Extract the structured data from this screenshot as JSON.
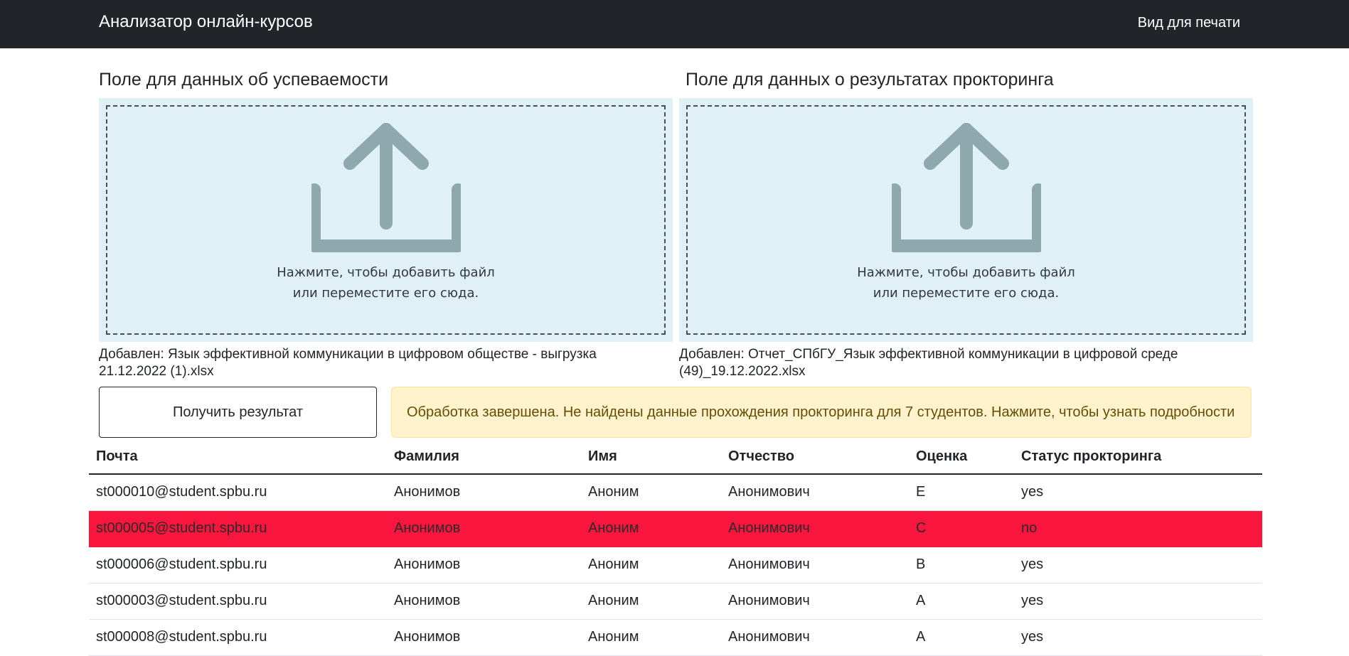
{
  "navbar": {
    "brand": "Анализатор онлайн-курсов",
    "print_link": "Вид для печати"
  },
  "upload_progress": {
    "title": "Поле для данных об успеваемости",
    "dropzone_line1": "Нажмите, чтобы добавить файл",
    "dropzone_line2": "или переместите его сюда.",
    "added_file": "Добавлен: Язык эффективной коммуникации в цифровом обществе - выгрузка 21.12.2022 (1).xlsx",
    "icon": "upload-icon"
  },
  "upload_proctoring": {
    "title": "Поле для данных о результатах прокторинга",
    "dropzone_line1": "Нажмите, чтобы добавить файл",
    "dropzone_line2": "или переместите его сюда.",
    "added_file": "Добавлен: Отчет_СПбГУ_Язык эффективной коммуникации в цифровой среде (49)_19.12.2022.xlsx",
    "icon": "upload-icon"
  },
  "actions": {
    "get_result_label": "Получить результат"
  },
  "alert": {
    "text": "Обработка завершена. Не найдены данные прохождения прокторинга для 7 студентов. Нажмите, чтобы узнать подробности"
  },
  "table": {
    "headers": [
      "Почта",
      "Фамилия",
      "Имя",
      "Отчество",
      "Оценка",
      "Статус прокторинга"
    ],
    "rows": [
      {
        "email": "st000010@student.spbu.ru",
        "surname": "Анонимов",
        "name": "Аноним",
        "patronymic": "Анонимович",
        "grade": "E",
        "proctoring": "yes",
        "flagged": false
      },
      {
        "email": "st000005@student.spbu.ru",
        "surname": "Анонимов",
        "name": "Аноним",
        "patronymic": "Анонимович",
        "grade": "C",
        "proctoring": "no",
        "flagged": true
      },
      {
        "email": "st000006@student.spbu.ru",
        "surname": "Анонимов",
        "name": "Аноним",
        "patronymic": "Анонимович",
        "grade": "B",
        "proctoring": "yes",
        "flagged": false
      },
      {
        "email": "st000003@student.spbu.ru",
        "surname": "Анонимов",
        "name": "Аноним",
        "patronymic": "Анонимович",
        "grade": "A",
        "proctoring": "yes",
        "flagged": false
      },
      {
        "email": "st000008@student.spbu.ru",
        "surname": "Анонимов",
        "name": "Аноним",
        "patronymic": "Анонимович",
        "grade": "A",
        "proctoring": "yes",
        "flagged": false
      }
    ]
  },
  "colors": {
    "navbar": "#212529",
    "dropzone_bg": "#dff0f6",
    "icon": "#8fa8ae",
    "alert_bg": "#fff3cd",
    "alert_text": "#664d03",
    "flagged_row": "#f8163e"
  }
}
